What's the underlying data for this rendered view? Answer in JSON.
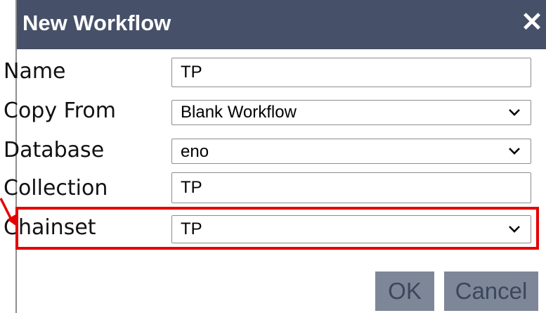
{
  "dialog": {
    "title": "New Workflow",
    "close_icon": "close-icon",
    "fields": [
      {
        "label": "Name",
        "type": "text",
        "value": "TP"
      },
      {
        "label": "Copy From",
        "type": "select",
        "value": "Blank Workflow"
      },
      {
        "label": "Database",
        "type": "select",
        "value": "eno"
      },
      {
        "label": "Collection",
        "type": "text",
        "value": "TP"
      },
      {
        "label": "Chainset",
        "type": "select",
        "value": "TP"
      }
    ],
    "buttons": {
      "ok": "OK",
      "cancel": "Cancel"
    }
  },
  "annotation": {
    "highlight_color": "#e60000",
    "target": "Chainset"
  },
  "colors": {
    "titlebar": "#465068",
    "button_bg": "#7e8797",
    "button_text": "#3c475d"
  }
}
